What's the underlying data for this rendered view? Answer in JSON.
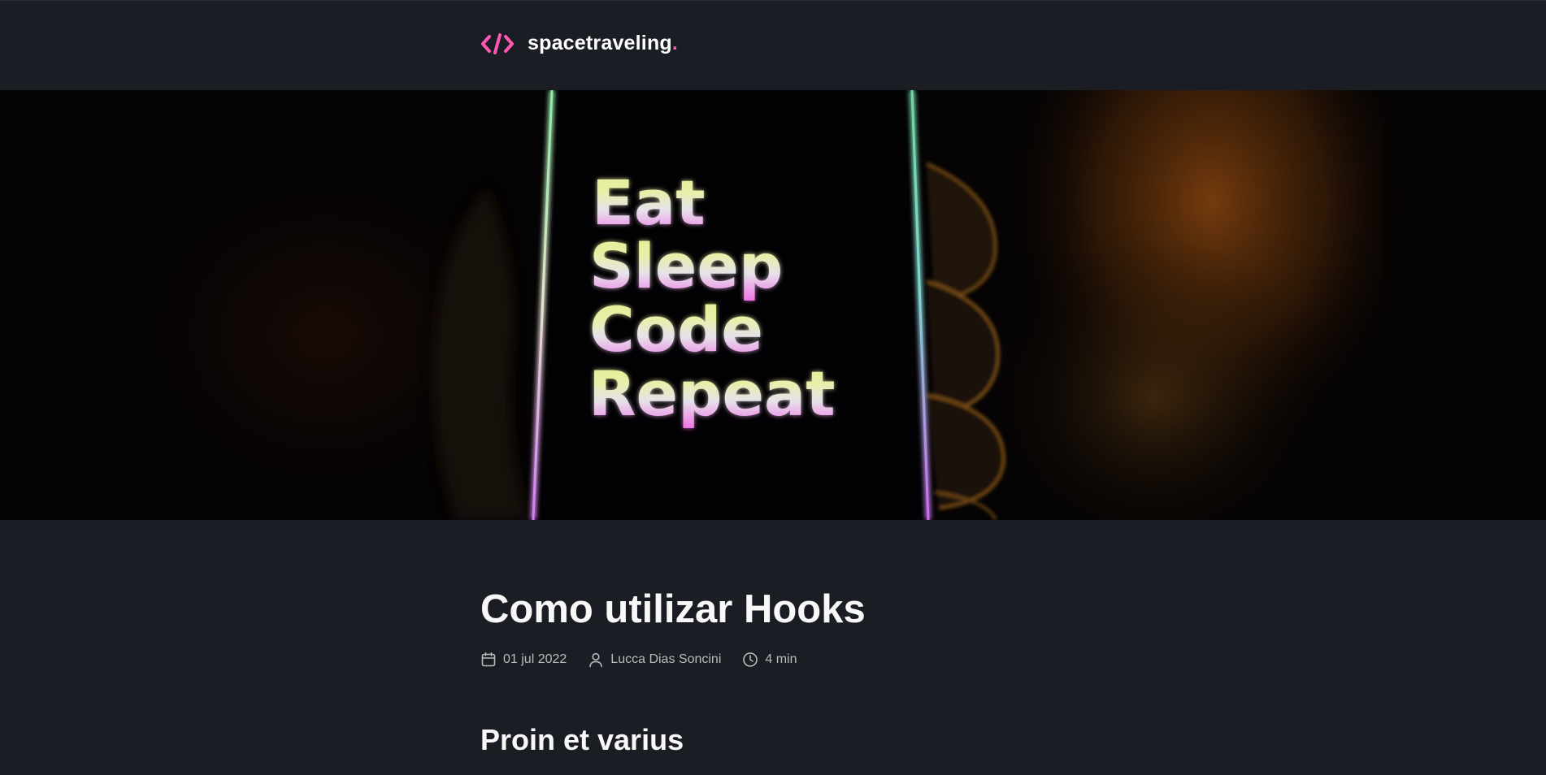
{
  "header": {
    "logo_text": "spacetraveling",
    "logo_dot": ".",
    "logo_icon": "code-brackets-icon",
    "accent_color": "#ff57b2"
  },
  "banner": {
    "lines": [
      "Eat",
      "Sleep",
      "Code",
      "Repeat"
    ]
  },
  "post": {
    "title": "Como utilizar Hooks",
    "date": "01 jul 2022",
    "author": "Lucca Dias Soncini",
    "reading_time": "4 min",
    "date_icon": "calendar-icon",
    "author_icon": "user-icon",
    "time_icon": "clock-icon"
  },
  "section": {
    "heading": "Proin et varius"
  }
}
